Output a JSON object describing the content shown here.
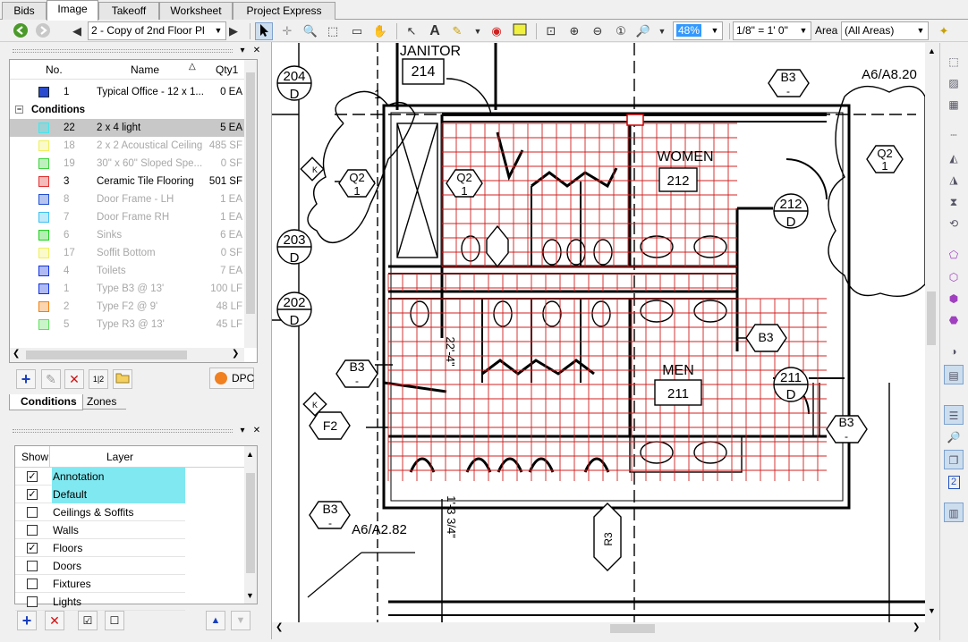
{
  "tabs": [
    "Bids",
    "Image",
    "Takeoff",
    "Worksheet",
    "Project Express"
  ],
  "active_tab": "Image",
  "toolbar": {
    "page_select": "2 - Copy of 2nd Floor Pl",
    "zoom": "48%",
    "scale": "1/8\" = 1' 0\"",
    "area_label": "Area",
    "area_value": "(All Areas)"
  },
  "conditions_panel": {
    "headers": {
      "no": "No.",
      "name": "Name",
      "qty": "Qty1"
    },
    "top_row": {
      "no": "1",
      "name": "Typical Office - 12 x 1...",
      "qty": "0 EA",
      "color": "#2a4ad0"
    },
    "group_label": "Conditions",
    "rows": [
      {
        "no": "22",
        "name": "2 x 4 light",
        "qty": "5 EA",
        "color": "#40e8f0",
        "selected": true,
        "dim": false
      },
      {
        "no": "18",
        "name": "2 x 2 Acoustical Ceiling",
        "qty": "485 SF",
        "color": "#f0f060",
        "selected": false,
        "dim": true
      },
      {
        "no": "19",
        "name": "30\" x 60\" Sloped Spe...",
        "qty": "0 SF",
        "color": "#40d040",
        "selected": false,
        "dim": true
      },
      {
        "no": "3",
        "name": "Ceramic Tile Flooring",
        "qty": "501 SF",
        "color": "#e03030",
        "selected": false,
        "dim": false
      },
      {
        "no": "8",
        "name": "Door Frame - LH",
        "qty": "1 EA",
        "color": "#2050d0",
        "selected": false,
        "dim": true
      },
      {
        "no": "7",
        "name": "Door Frame RH",
        "qty": "1 EA",
        "color": "#40c0f0",
        "selected": false,
        "dim": true
      },
      {
        "no": "6",
        "name": "Sinks",
        "qty": "6 EA",
        "color": "#20d020",
        "selected": false,
        "dim": true
      },
      {
        "no": "17",
        "name": "Soffit Bottom",
        "qty": "0 SF",
        "color": "#f0f060",
        "selected": false,
        "dim": true
      },
      {
        "no": "4",
        "name": "Toilets",
        "qty": "7 EA",
        "color": "#1030e0",
        "selected": false,
        "dim": true
      },
      {
        "no": "1",
        "name": "Type B3 @ 13'",
        "qty": "100 LF",
        "color": "#1030e0",
        "selected": false,
        "dim": true
      },
      {
        "no": "2",
        "name": "Type F2 @ 9'",
        "qty": "48 LF",
        "color": "#f08010",
        "selected": false,
        "dim": true
      },
      {
        "no": "5",
        "name": "Type R3 @ 13'",
        "qty": "45 LF",
        "color": "#60e060",
        "selected": false,
        "dim": true
      }
    ],
    "dpc_label": "DPC",
    "bottom_tabs": [
      "Conditions",
      "Zones"
    ]
  },
  "layers_panel": {
    "headers": {
      "show": "Show",
      "layer": "Layer"
    },
    "rows": [
      {
        "name": "Annotation",
        "checked": true,
        "highlight": true
      },
      {
        "name": "Default",
        "checked": true,
        "highlight": true
      },
      {
        "name": "Ceilings & Soffits",
        "checked": false,
        "highlight": false
      },
      {
        "name": "Walls",
        "checked": false,
        "highlight": false
      },
      {
        "name": "Floors",
        "checked": true,
        "highlight": false
      },
      {
        "name": "Doors",
        "checked": false,
        "highlight": false
      },
      {
        "name": "Fixtures",
        "checked": false,
        "highlight": false
      },
      {
        "name": "Lights",
        "checked": false,
        "highlight": false
      }
    ]
  },
  "drawing_labels": {
    "janitor": "JANITOR",
    "janitor_no": "214",
    "women": "WOMEN",
    "women_no": "212",
    "men": "MEN",
    "men_no": "211",
    "ref_a6a8": "A6/A8.20",
    "ref_a6a2": "A6/A2.82",
    "dim_22": "22'-4\"",
    "dim_1": "1'-3 3/4\"",
    "tag_b3": "B3",
    "tag_b3_sub": "-",
    "tag_q2": "Q2",
    "tag_q2_sub": "1",
    "tag_f2": "F2",
    "tag_r3": "R3",
    "tag_k": "K",
    "tag_d": "D",
    "door_204": "204",
    "door_203": "203",
    "door_202": "202",
    "door_212": "212",
    "door_211": "211",
    "tag_1": "1",
    "badge_2": "2"
  }
}
